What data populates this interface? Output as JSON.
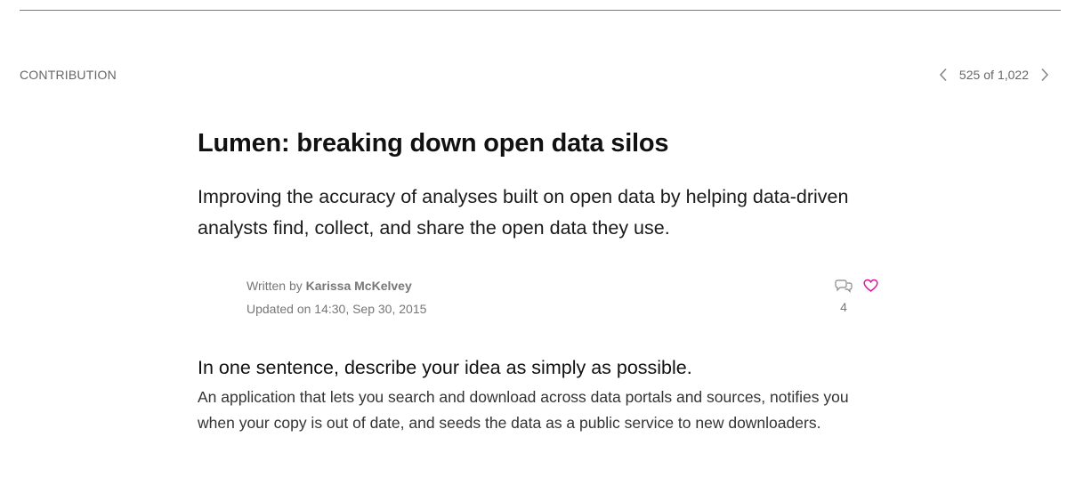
{
  "header": {
    "section_label": "CONTRIBUTION",
    "pager": {
      "current": "525",
      "of": "of",
      "total": "1,022",
      "prev_icon": "chevron-left-icon",
      "next_icon": "chevron-right-icon"
    }
  },
  "article": {
    "title": "Lumen: breaking down open data silos",
    "summary": "Improving the accuracy of analyses built on open data by helping data-driven analysts find, collect, and share the open data they use.",
    "byline": {
      "written_by_prefix": "Written by",
      "author": "Karissa McKelvey",
      "updated": "Updated on 14:30, Sep 30, 2015"
    },
    "actions": {
      "comment_icon": "comment-icon",
      "comment_count": "4",
      "like_icon": "heart-icon",
      "like_color": "#e0149b"
    },
    "question": "In one sentence, describe your idea as simply as possible.",
    "answer": "An application that lets you search and download across data portals and sources, notifies you when your copy is out of date, and seeds the data as a public service to new downloaders."
  }
}
